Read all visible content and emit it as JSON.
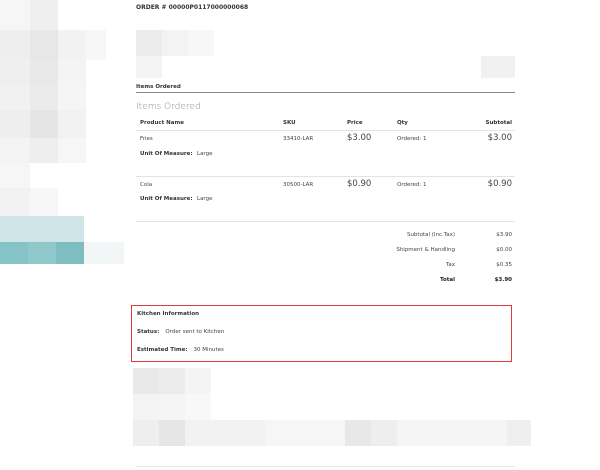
{
  "order": {
    "title": "ORDER # 00000P0117000000068"
  },
  "items_section": {
    "heading": "Items Ordered",
    "title": "Items Ordered",
    "columns": [
      "Product Name",
      "SKU",
      "Price",
      "Qty",
      "Subtotal"
    ],
    "uom_label": "Unit Of Measure:",
    "rows": [
      {
        "name": "Fries",
        "sku": "33410-LAR",
        "price": "$3.00",
        "qty": "Ordered: 1",
        "subtotal": "$3.00",
        "uom": "Large"
      },
      {
        "name": "Cola",
        "sku": "30500-LAR",
        "price": "$0.90",
        "qty": "Ordered: 1",
        "subtotal": "$0.90",
        "uom": "Large"
      }
    ]
  },
  "totals": [
    {
      "label": "Subtotal (Inc.Tax)",
      "value": "$3.90",
      "bold": false
    },
    {
      "label": "Shipment & Handling",
      "value": "$0.00",
      "bold": false
    },
    {
      "label": "Tax",
      "value": "$0.35",
      "bold": false
    },
    {
      "label": "Total",
      "value": "$3.90",
      "bold": true
    }
  ],
  "kitchen": {
    "title": "Kitchen Information",
    "status_label": "Status:",
    "status_value": "Order sent to Kitchen",
    "time_label": "Estimated Time:",
    "time_value": "30 Minutes"
  },
  "colors": {
    "accent": "#7fbfc2",
    "highlight_border": "#e23b3b"
  }
}
